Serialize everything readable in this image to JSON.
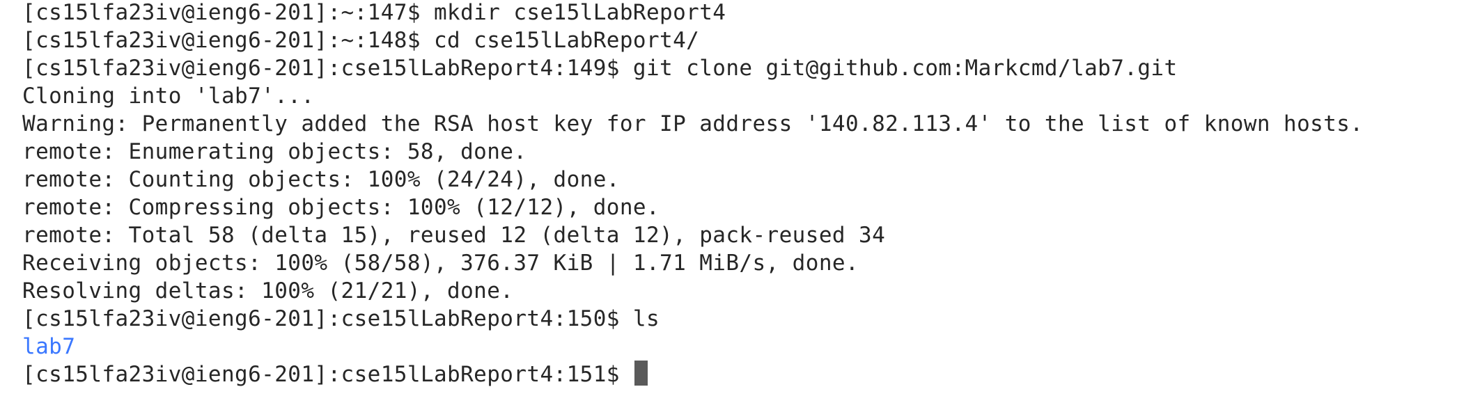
{
  "terminal": {
    "lines": [
      "[cs15lfa23iv@ieng6-201]:~:147$ mkdir cse15lLabReport4",
      "[cs15lfa23iv@ieng6-201]:~:148$ cd cse15lLabReport4/",
      "[cs15lfa23iv@ieng6-201]:cse15lLabReport4:149$ git clone git@github.com:Markcmd/lab7.git",
      "Cloning into 'lab7'...",
      "Warning: Permanently added the RSA host key for IP address '140.82.113.4' to the list of known hosts.",
      "remote: Enumerating objects: 58, done.",
      "remote: Counting objects: 100% (24/24), done.",
      "remote: Compressing objects: 100% (12/12), done.",
      "remote: Total 58 (delta 15), reused 12 (delta 12), pack-reused 34",
      "Receiving objects: 100% (58/58), 376.37 KiB | 1.71 MiB/s, done.",
      "Resolving deltas: 100% (21/21), done.",
      "[cs15lfa23iv@ieng6-201]:cse15lLabReport4:150$ ls"
    ],
    "ls_output": "lab7",
    "current_prompt": "[cs15lfa23iv@ieng6-201]:cse15lLabReport4:151$ ",
    "colors": {
      "background": "#ffffff",
      "text": "#262626",
      "directory": "#3b78ff",
      "cursor": "#5a5a5a"
    }
  }
}
